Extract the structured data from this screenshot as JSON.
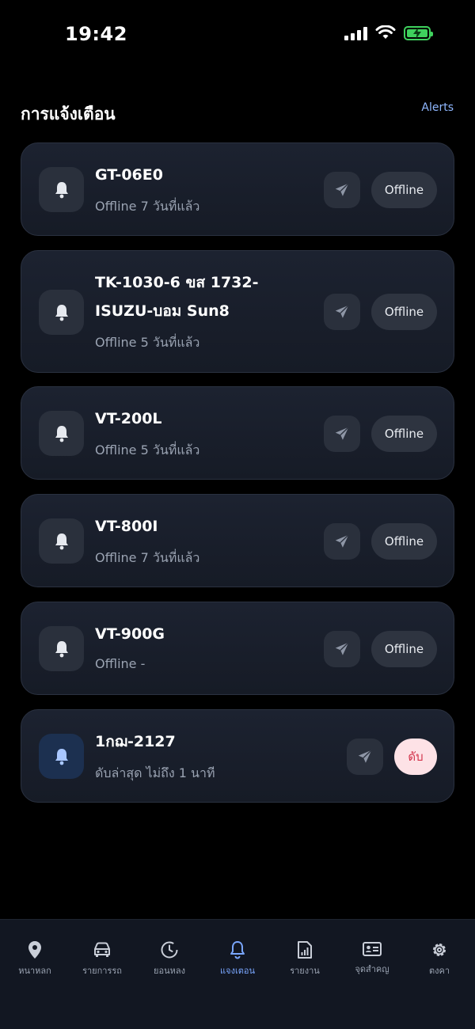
{
  "status_bar": {
    "time": "19:42"
  },
  "header": {
    "title": "การแจ้งเตือน",
    "alerts_label": "Alerts"
  },
  "alerts": [
    {
      "title": "GT-06E0",
      "subtitle": "Offline 7 วันที่แล้ว",
      "state": "Offline",
      "active": false
    },
    {
      "title": "TK-1030-6 ขส 1732- ISUZU-บอม Sun8",
      "subtitle": "Offline 5 วันที่แล้ว",
      "state": "Offline",
      "active": false
    },
    {
      "title": "VT-200L",
      "subtitle": "Offline 5 วันที่แล้ว",
      "state": "Offline",
      "active": false
    },
    {
      "title": "VT-800I",
      "subtitle": "Offline 7 วันที่แล้ว",
      "state": "Offline",
      "active": false
    },
    {
      "title": "VT-900G",
      "subtitle": "Offline -",
      "state": "Offline",
      "active": false
    },
    {
      "title": "1กฌ-2127",
      "subtitle": "ดับล่าสุด ไม่ถึง 1 นาที",
      "state": "ดับ",
      "active": true
    }
  ],
  "bottom_nav": [
    {
      "label": "หนาหลก",
      "icon": "map-pin-icon",
      "active": false
    },
    {
      "label": "รายการรถ",
      "icon": "car-icon",
      "active": false
    },
    {
      "label": "ยอนหลง",
      "icon": "history-clock-icon",
      "active": false
    },
    {
      "label": "แจงเตอน",
      "icon": "bell-icon",
      "active": true
    },
    {
      "label": "รายงาน",
      "icon": "report-icon",
      "active": false
    },
    {
      "label": "จุดสำคญ",
      "icon": "id-card-icon",
      "active": false
    },
    {
      "label": "ตงคา",
      "icon": "gear-icon",
      "active": false
    }
  ],
  "colors": {
    "accent": "#7aa7ff",
    "battery": "#3fd15d",
    "off_state_bg": "#fde2e6",
    "off_state_text": "#d3344b"
  }
}
